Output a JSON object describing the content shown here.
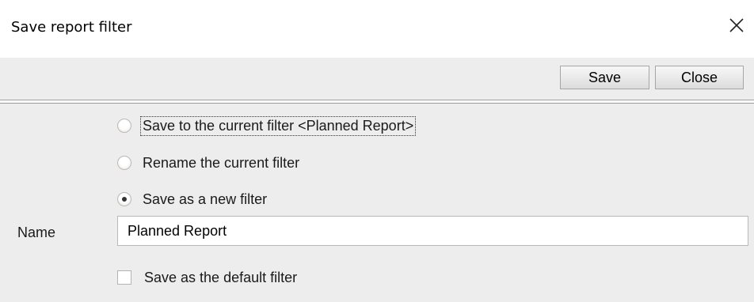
{
  "window": {
    "title": "Save report filter",
    "close_icon": "close-icon"
  },
  "toolbar": {
    "save_label": "Save",
    "close_label": "Close"
  },
  "options": [
    {
      "label": "Save to the current filter <Planned Report>",
      "selected": false,
      "focused": true
    },
    {
      "label": "Rename the current filter",
      "selected": false
    },
    {
      "label": "Save as a new filter",
      "selected": true
    }
  ],
  "name_field": {
    "label": "Name",
    "value": "Planned Report"
  },
  "default_checkbox": {
    "label": "Save as the default filter",
    "checked": false
  }
}
